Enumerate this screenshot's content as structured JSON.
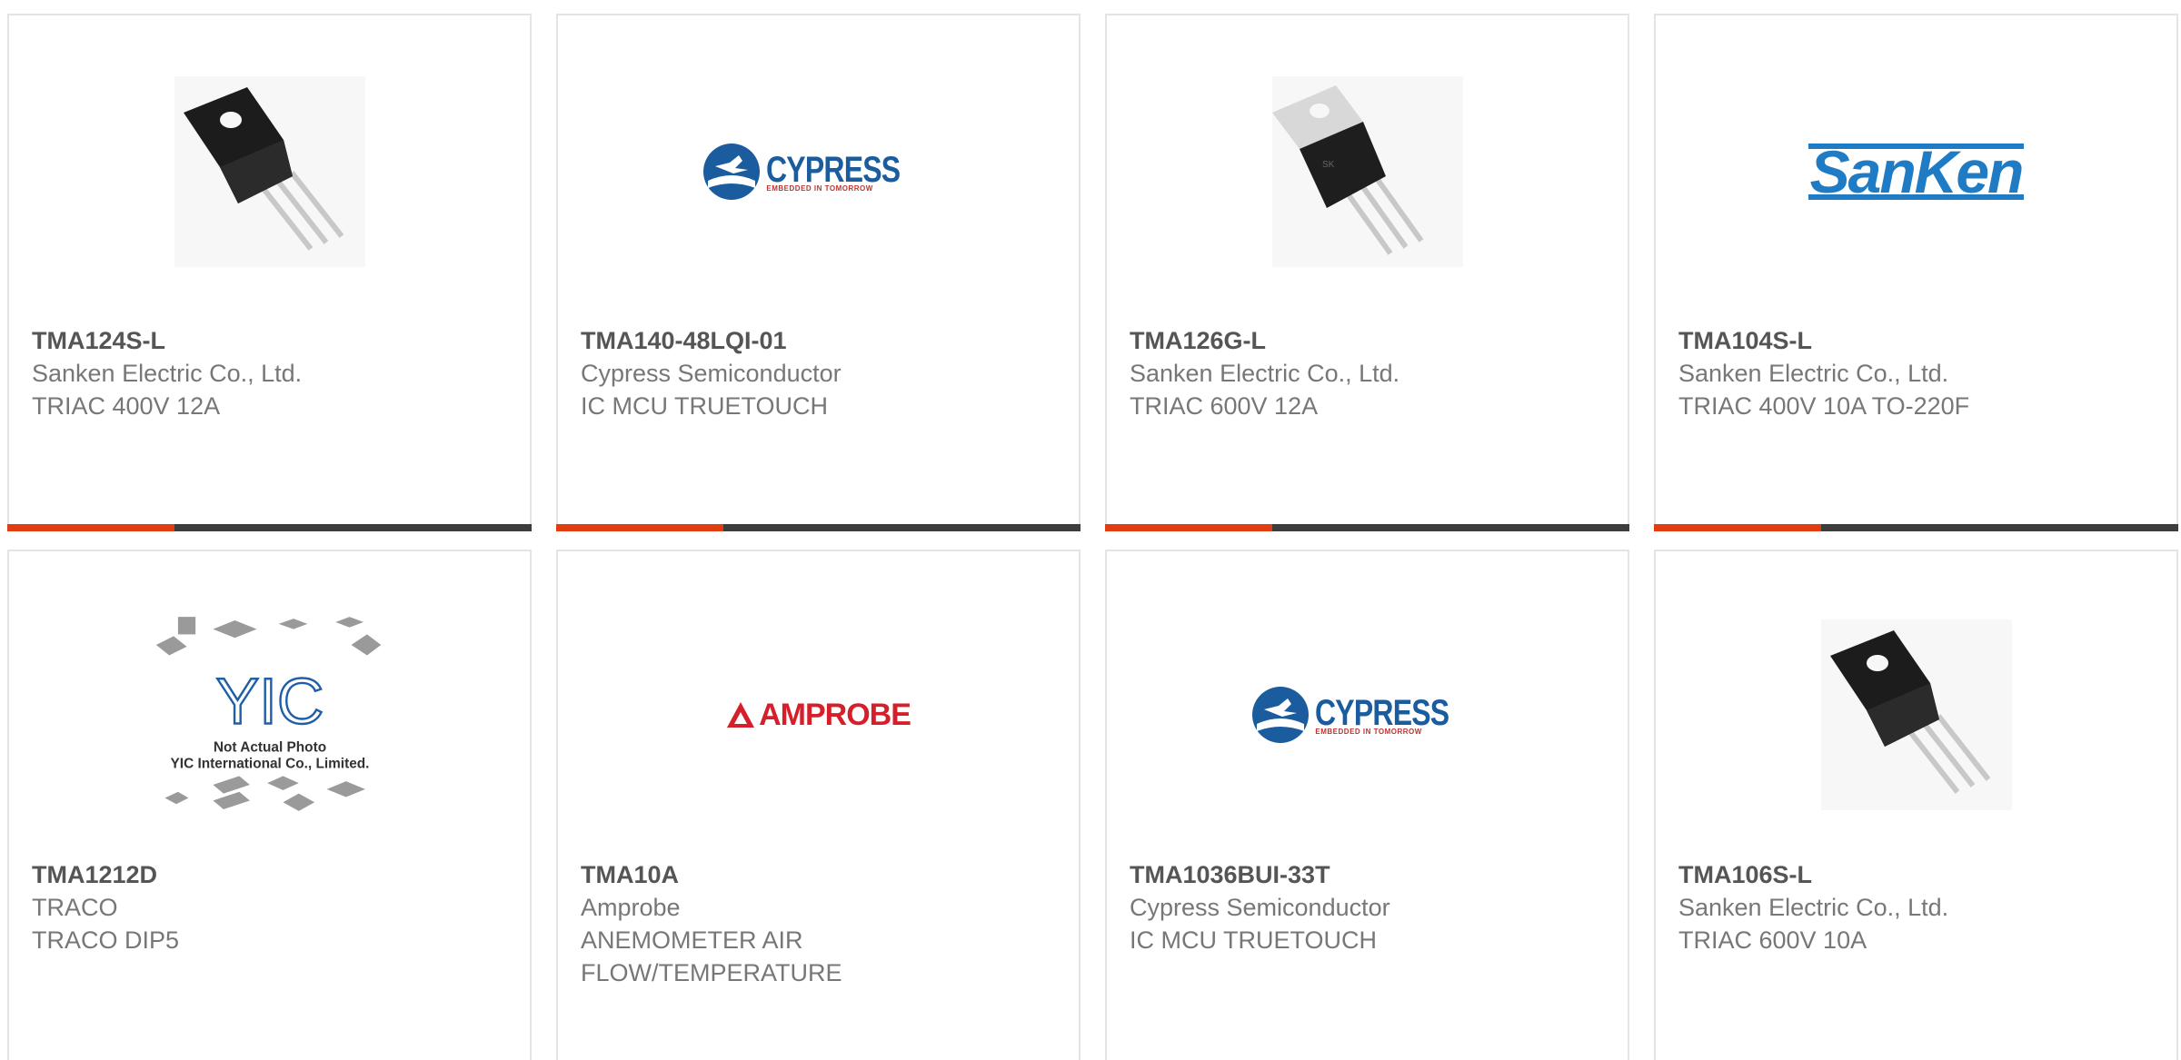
{
  "colors": {
    "accent": "#e23d10",
    "bar": "#3d3d3d",
    "card_border": "#e4e4e4",
    "part_text": "#555555",
    "body_text": "#777777"
  },
  "products": [
    {
      "part": "TMA124S-L",
      "manufacturer": "Sanken Electric Co., Ltd.",
      "description": "TRIAC 400V 12A",
      "image": "to220f-black-package"
    },
    {
      "part": "TMA140-48LQI-01",
      "manufacturer": "Cypress Semiconductor",
      "description": "IC MCU TRUETOUCH",
      "image": "cypress-logo",
      "logo_text": "CYPRESS",
      "logo_tagline": "EMBEDDED IN TOMORROW"
    },
    {
      "part": "TMA126G-L",
      "manufacturer": "Sanken Electric Co., Ltd.",
      "description": "TRIAC 600V 12A",
      "image": "to220-metal-tab-package"
    },
    {
      "part": "TMA104S-L",
      "manufacturer": "Sanken Electric Co., Ltd.",
      "description": "TRIAC 400V 10A TO-220F",
      "image": "sanken-logo",
      "logo_text": "SanKen"
    },
    {
      "part": "TMA1212D",
      "manufacturer": "TRACO",
      "description": "TRACO DIP5",
      "image": "yic-not-actual-photo",
      "logo_text": "YIC",
      "image_caption_1": "Not Actual Photo",
      "image_caption_2": "YIC International Co., Limited."
    },
    {
      "part": "TMA10A",
      "manufacturer": "Amprobe",
      "description_1": "ANEMOMETER AIR",
      "description_2": "FLOW/TEMPERATURE",
      "image": "amprobe-logo",
      "logo_text": "AMPROBE"
    },
    {
      "part": "TMA1036BUI-33T",
      "manufacturer": "Cypress Semiconductor",
      "description": "IC MCU TRUETOUCH",
      "image": "cypress-logo",
      "logo_text": "CYPRESS",
      "logo_tagline": "EMBEDDED IN TOMORROW"
    },
    {
      "part": "TMA106S-L",
      "manufacturer": "Sanken Electric Co., Ltd.",
      "description": "TRIAC 600V 10A",
      "image": "to220f-black-package"
    }
  ]
}
